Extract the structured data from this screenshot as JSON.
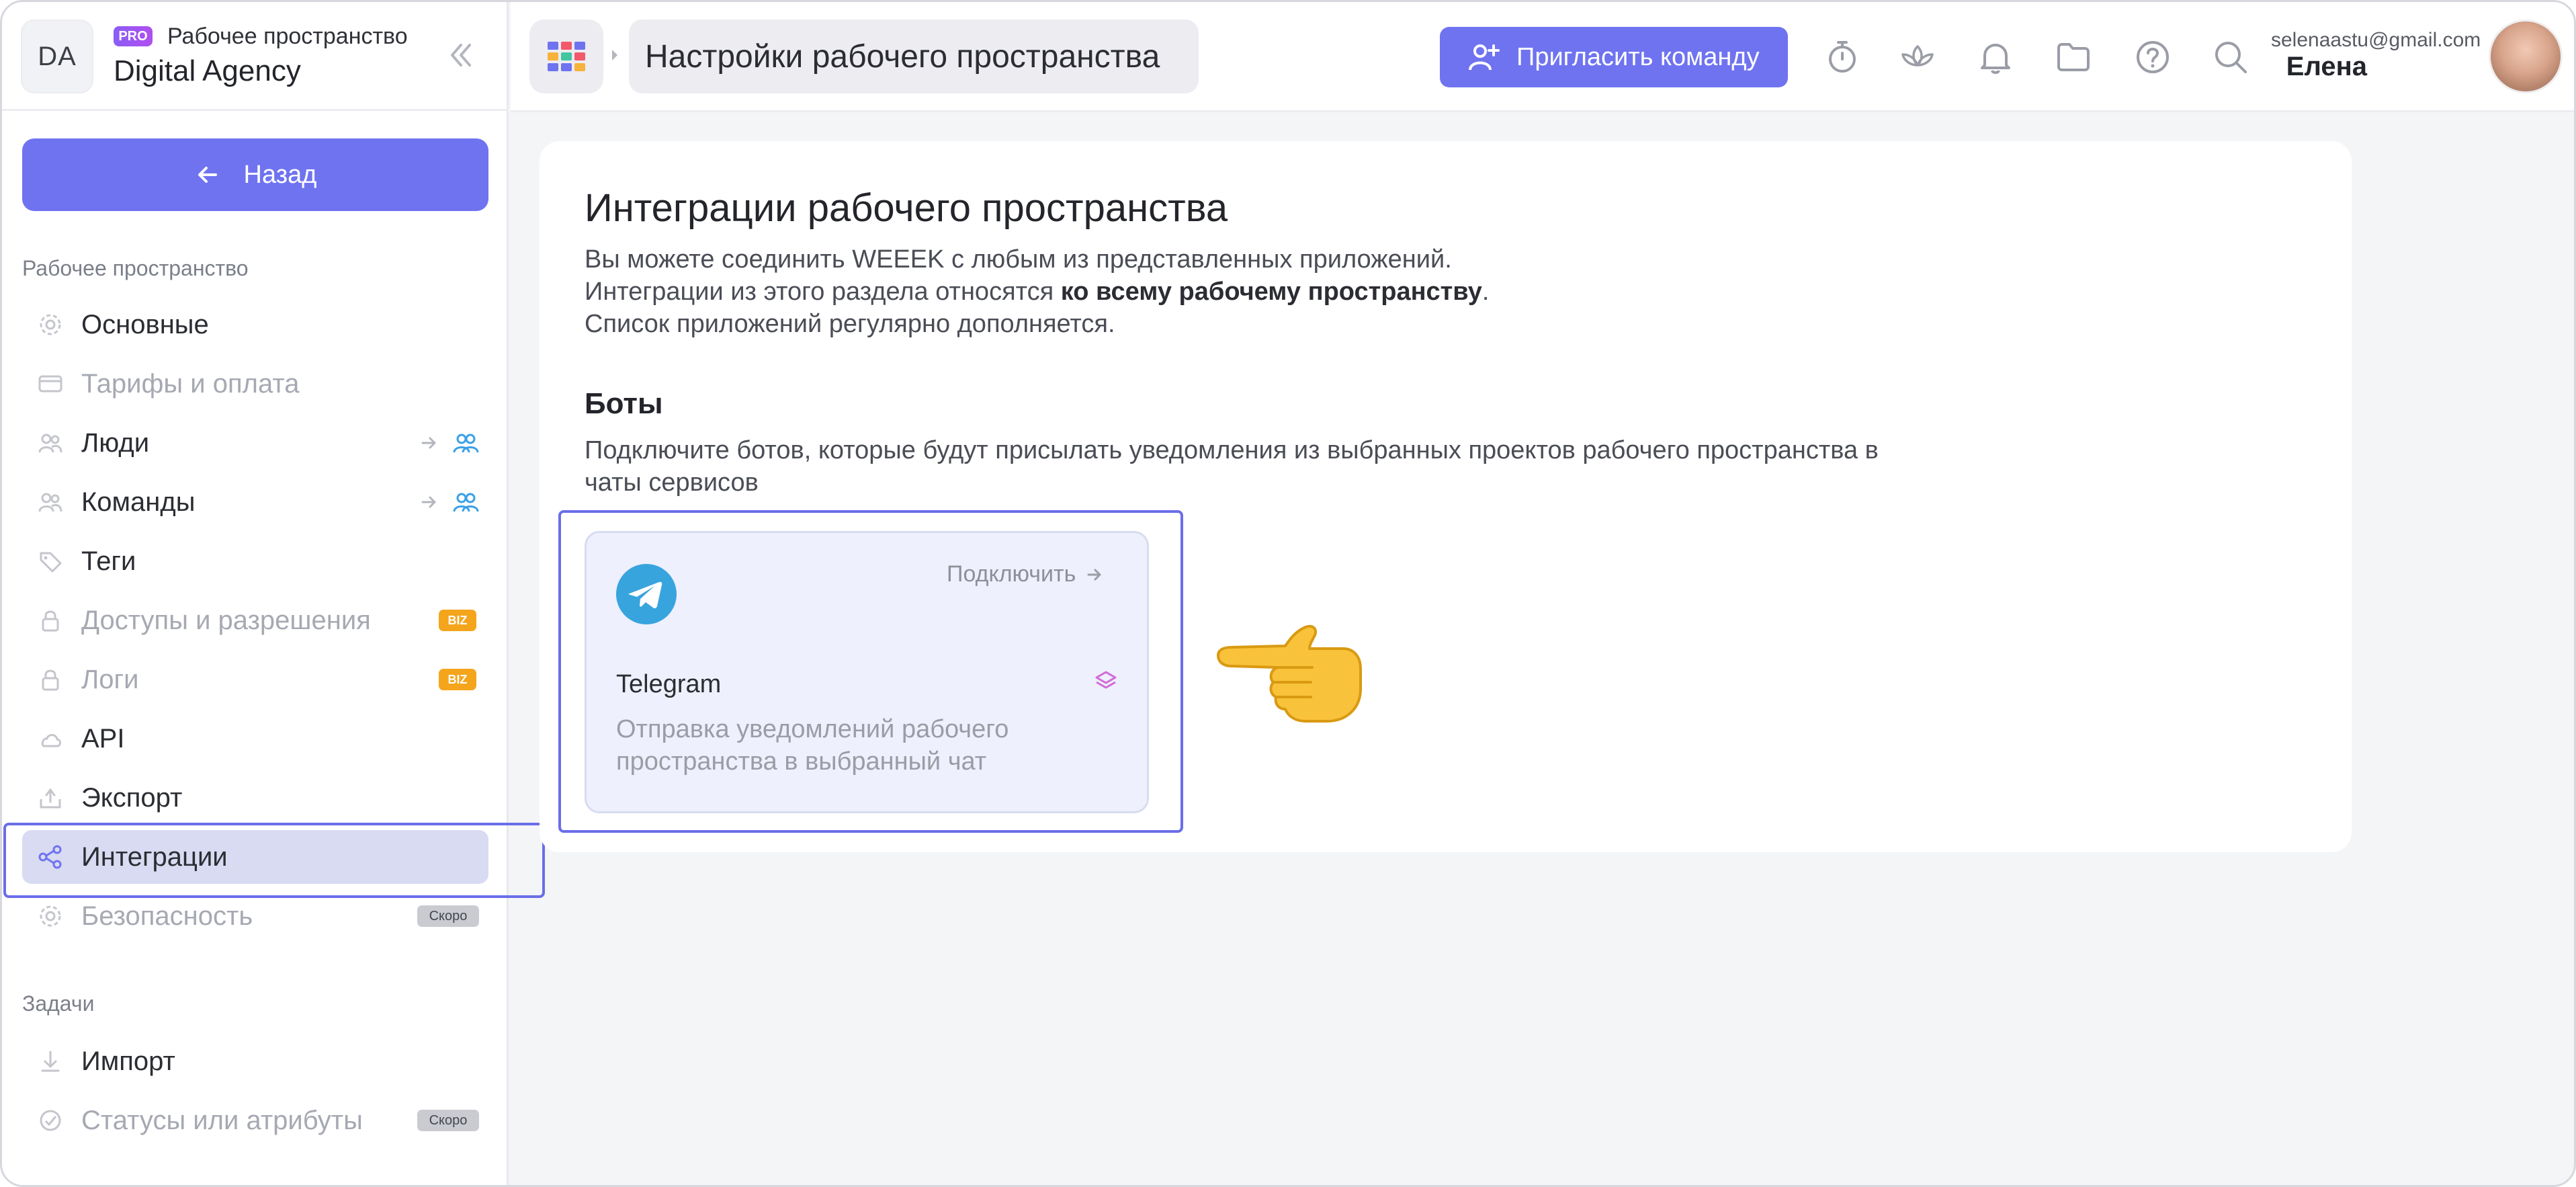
{
  "sidebar": {
    "workspace_initials": "DA",
    "plan_badge": "PRO",
    "workspace_label": "Рабочее пространство",
    "workspace_name": "Digital Agency",
    "back_label": "Назад",
    "section_workspace": "Рабочее пространство",
    "section_tasks": "Задачи",
    "items": [
      {
        "label": "Основные",
        "icon": "gear-icon",
        "dim": false
      },
      {
        "label": "Тарифы и оплата",
        "icon": "card-icon",
        "dim": true
      },
      {
        "label": "Люди",
        "icon": "people-icon",
        "dim": false
      },
      {
        "label": "Команды",
        "icon": "people-icon",
        "dim": false
      },
      {
        "label": "Теги",
        "icon": "tag-icon",
        "dim": false
      },
      {
        "label": "Доступы и разрешения",
        "icon": "lock-icon",
        "dim": true,
        "badge": "BIZ"
      },
      {
        "label": "Логи",
        "icon": "lock-icon",
        "dim": true,
        "badge": "BIZ"
      },
      {
        "label": "API",
        "icon": "cloud-icon",
        "dim": false
      },
      {
        "label": "Экспорт",
        "icon": "export-icon",
        "dim": false
      },
      {
        "label": "Интеграции",
        "icon": "integrations-icon",
        "dim": false,
        "active": true
      },
      {
        "label": "Безопасность",
        "icon": "gear-icon",
        "dim": true,
        "badge": "Скоро"
      }
    ],
    "task_items": [
      {
        "label": "Импорт",
        "icon": "import-icon",
        "dim": false
      },
      {
        "label": "Статусы или атрибуты",
        "icon": "status-icon",
        "dim": true,
        "badge": "Скоро"
      }
    ]
  },
  "topbar": {
    "breadcrumb": "Настройки рабочего пространства",
    "invite_label": "Пригласить команду",
    "user_email": "selenaastu@gmail.com",
    "user_name": "Елена"
  },
  "main": {
    "title": "Интеграции рабочего пространства",
    "desc_line1": "Вы можете соединить WEEEK с любым из представленных приложений.",
    "desc_line2_pre": "Интеграции из этого раздела относятся ",
    "desc_line2_bold": "ко всему рабочему пространству",
    "desc_line2_post": ".",
    "desc_line3": "Список приложений регулярно дополняется.",
    "bots_title": "Боты",
    "bots_desc": "Подключите ботов, которые будут присылать уведомления из выбранных проектов рабочего пространства в чаты сервисов",
    "telegram": {
      "name": "Telegram",
      "connect_label": "Подключить",
      "description": "Отправка уведомлений рабочего пространства в выбранный чат"
    }
  },
  "colors": {
    "accent": "#6f73f0",
    "biz_badge": "#f4a51c",
    "telegram": "#38a4de",
    "highlight": "#6a6ee8"
  }
}
